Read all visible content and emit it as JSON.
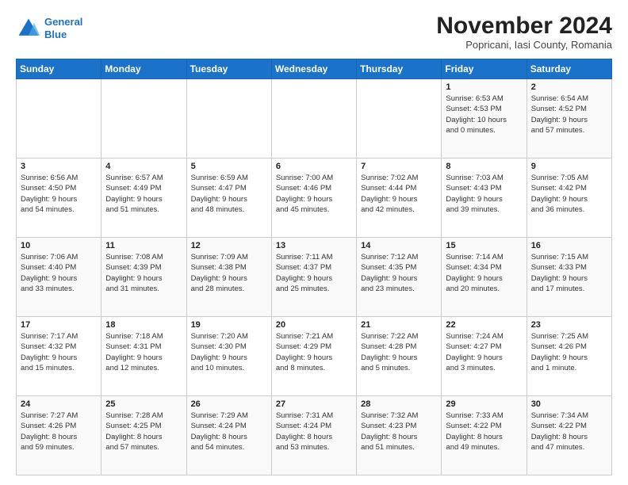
{
  "logo": {
    "line1": "General",
    "line2": "Blue"
  },
  "title": "November 2024",
  "subtitle": "Popricani, Iasi County, Romania",
  "days_of_week": [
    "Sunday",
    "Monday",
    "Tuesday",
    "Wednesday",
    "Thursday",
    "Friday",
    "Saturday"
  ],
  "weeks": [
    [
      {
        "day": "",
        "info": ""
      },
      {
        "day": "",
        "info": ""
      },
      {
        "day": "",
        "info": ""
      },
      {
        "day": "",
        "info": ""
      },
      {
        "day": "",
        "info": ""
      },
      {
        "day": "1",
        "info": "Sunrise: 6:53 AM\nSunset: 4:53 PM\nDaylight: 10 hours\nand 0 minutes."
      },
      {
        "day": "2",
        "info": "Sunrise: 6:54 AM\nSunset: 4:52 PM\nDaylight: 9 hours\nand 57 minutes."
      }
    ],
    [
      {
        "day": "3",
        "info": "Sunrise: 6:56 AM\nSunset: 4:50 PM\nDaylight: 9 hours\nand 54 minutes."
      },
      {
        "day": "4",
        "info": "Sunrise: 6:57 AM\nSunset: 4:49 PM\nDaylight: 9 hours\nand 51 minutes."
      },
      {
        "day": "5",
        "info": "Sunrise: 6:59 AM\nSunset: 4:47 PM\nDaylight: 9 hours\nand 48 minutes."
      },
      {
        "day": "6",
        "info": "Sunrise: 7:00 AM\nSunset: 4:46 PM\nDaylight: 9 hours\nand 45 minutes."
      },
      {
        "day": "7",
        "info": "Sunrise: 7:02 AM\nSunset: 4:44 PM\nDaylight: 9 hours\nand 42 minutes."
      },
      {
        "day": "8",
        "info": "Sunrise: 7:03 AM\nSunset: 4:43 PM\nDaylight: 9 hours\nand 39 minutes."
      },
      {
        "day": "9",
        "info": "Sunrise: 7:05 AM\nSunset: 4:42 PM\nDaylight: 9 hours\nand 36 minutes."
      }
    ],
    [
      {
        "day": "10",
        "info": "Sunrise: 7:06 AM\nSunset: 4:40 PM\nDaylight: 9 hours\nand 33 minutes."
      },
      {
        "day": "11",
        "info": "Sunrise: 7:08 AM\nSunset: 4:39 PM\nDaylight: 9 hours\nand 31 minutes."
      },
      {
        "day": "12",
        "info": "Sunrise: 7:09 AM\nSunset: 4:38 PM\nDaylight: 9 hours\nand 28 minutes."
      },
      {
        "day": "13",
        "info": "Sunrise: 7:11 AM\nSunset: 4:37 PM\nDaylight: 9 hours\nand 25 minutes."
      },
      {
        "day": "14",
        "info": "Sunrise: 7:12 AM\nSunset: 4:35 PM\nDaylight: 9 hours\nand 23 minutes."
      },
      {
        "day": "15",
        "info": "Sunrise: 7:14 AM\nSunset: 4:34 PM\nDaylight: 9 hours\nand 20 minutes."
      },
      {
        "day": "16",
        "info": "Sunrise: 7:15 AM\nSunset: 4:33 PM\nDaylight: 9 hours\nand 17 minutes."
      }
    ],
    [
      {
        "day": "17",
        "info": "Sunrise: 7:17 AM\nSunset: 4:32 PM\nDaylight: 9 hours\nand 15 minutes."
      },
      {
        "day": "18",
        "info": "Sunrise: 7:18 AM\nSunset: 4:31 PM\nDaylight: 9 hours\nand 12 minutes."
      },
      {
        "day": "19",
        "info": "Sunrise: 7:20 AM\nSunset: 4:30 PM\nDaylight: 9 hours\nand 10 minutes."
      },
      {
        "day": "20",
        "info": "Sunrise: 7:21 AM\nSunset: 4:29 PM\nDaylight: 9 hours\nand 8 minutes."
      },
      {
        "day": "21",
        "info": "Sunrise: 7:22 AM\nSunset: 4:28 PM\nDaylight: 9 hours\nand 5 minutes."
      },
      {
        "day": "22",
        "info": "Sunrise: 7:24 AM\nSunset: 4:27 PM\nDaylight: 9 hours\nand 3 minutes."
      },
      {
        "day": "23",
        "info": "Sunrise: 7:25 AM\nSunset: 4:26 PM\nDaylight: 9 hours\nand 1 minute."
      }
    ],
    [
      {
        "day": "24",
        "info": "Sunrise: 7:27 AM\nSunset: 4:26 PM\nDaylight: 8 hours\nand 59 minutes."
      },
      {
        "day": "25",
        "info": "Sunrise: 7:28 AM\nSunset: 4:25 PM\nDaylight: 8 hours\nand 57 minutes."
      },
      {
        "day": "26",
        "info": "Sunrise: 7:29 AM\nSunset: 4:24 PM\nDaylight: 8 hours\nand 54 minutes."
      },
      {
        "day": "27",
        "info": "Sunrise: 7:31 AM\nSunset: 4:24 PM\nDaylight: 8 hours\nand 53 minutes."
      },
      {
        "day": "28",
        "info": "Sunrise: 7:32 AM\nSunset: 4:23 PM\nDaylight: 8 hours\nand 51 minutes."
      },
      {
        "day": "29",
        "info": "Sunrise: 7:33 AM\nSunset: 4:22 PM\nDaylight: 8 hours\nand 49 minutes."
      },
      {
        "day": "30",
        "info": "Sunrise: 7:34 AM\nSunset: 4:22 PM\nDaylight: 8 hours\nand 47 minutes."
      }
    ]
  ]
}
